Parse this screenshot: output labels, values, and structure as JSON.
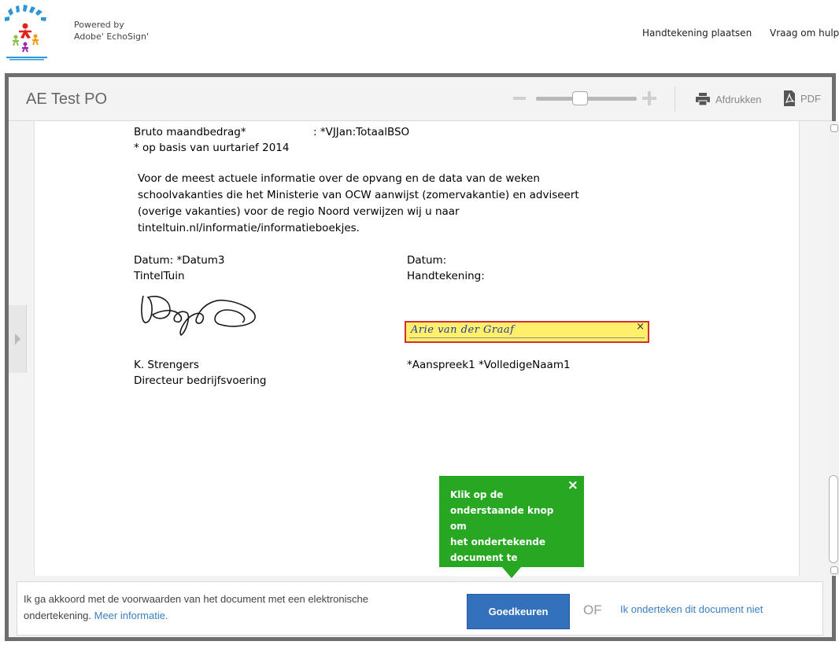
{
  "header": {
    "powered_by_line1": "Powered by",
    "powered_by_line2": "Adobe' EchoSign'",
    "nav_sign": "Handtekening plaatsen",
    "nav_help": "Vraag om hulp"
  },
  "viewer": {
    "title": "AE Test PO",
    "print_label": "Afdrukken",
    "pdf_label": "PDF",
    "zoom_level": 0.43
  },
  "document": {
    "gross_label": "Bruto maandbedrag*",
    "gross_value": ":   *VJJan:TotaalBSO",
    "rate_note": "* op basis van uurtarief 2014",
    "info_lines": [
      "Voor de meest actuele informatie over de opvang en de data van de weken",
      "schoolvakanties die het Ministerie van OCW aanwijst (zomervakantie) en adviseert",
      "(overige vakanties) voor de regio Noord verwijzen wij u naar",
      "tinteltuin.nl/informatie/informatieboekjes."
    ],
    "left_date": "Datum:  *Datum3",
    "left_org": "TintelTuin",
    "right_date": "Datum:",
    "right_sign": "Handtekening:",
    "signature_value": "Arie van der Graaf",
    "signature_close": "×",
    "left_name": "K. Strengers",
    "left_role": "Directeur bedrijfsvoering",
    "right_name": "*Aanspreek1 *VolledigeNaam1"
  },
  "footer": {
    "consent_text": "Ik ga akkoord met de voorwaarden van het document met een elektronische ondertekening. ",
    "more_info_link": "Meer informatie.",
    "approve_button": "Goedkeuren",
    "or_label": "OF",
    "decline_link": "Ik onderteken dit document niet"
  },
  "tooltip": {
    "text_lines": [
      "Klik op de",
      "onderstaande knop om",
      "het ondertekende",
      "document te voltooien."
    ],
    "close": "×"
  },
  "colors": {
    "approve_blue": "#3471bd",
    "tooltip_green": "#27a722",
    "signature_field_yellow": "#ffef6b",
    "signature_field_border": "#d32f2f",
    "link_blue": "#3a7fc2"
  }
}
